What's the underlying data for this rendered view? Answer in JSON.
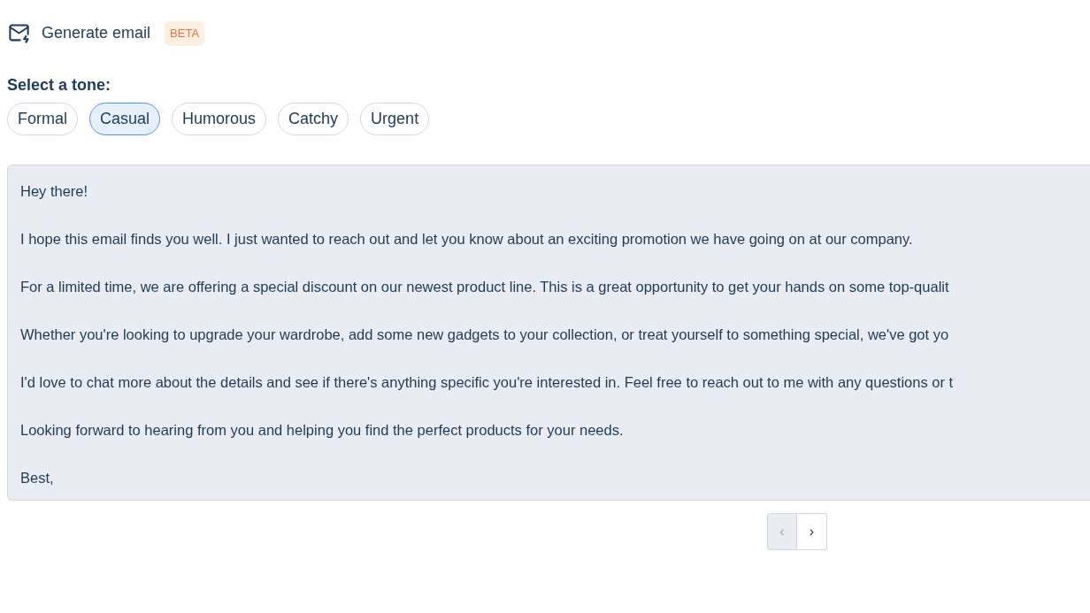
{
  "header": {
    "title": "Generate email",
    "badge": "BETA"
  },
  "tone_picker": {
    "label": "Select a tone:",
    "tones": [
      {
        "label": "Formal",
        "selected": false
      },
      {
        "label": "Casual",
        "selected": true
      },
      {
        "label": "Humorous",
        "selected": false
      },
      {
        "label": "Catchy",
        "selected": false
      },
      {
        "label": "Urgent",
        "selected": false
      }
    ]
  },
  "email_body": {
    "paragraphs": [
      "Hey there!",
      "I hope this email finds you well. I just wanted to reach out and let you know about an exciting promotion we have going on at our company.",
      "For a limited time, we are offering a special discount on our newest product line. This is a great opportunity to get your hands on some top-qualit",
      "Whether you're looking to upgrade your wardrobe, add some new gadgets to your collection, or treat yourself to something special, we've got yo",
      "I'd love to chat more about the details and see if there's anything specific you're interested in. Feel free to reach out to me with any questions or t",
      "Looking forward to hearing from you and helping you find the perfect products for your needs.",
      "Best,"
    ]
  },
  "pagination": [
    {
      "label": "‹",
      "disabled": true
    },
    {
      "label": "›",
      "disabled": false
    }
  ]
}
